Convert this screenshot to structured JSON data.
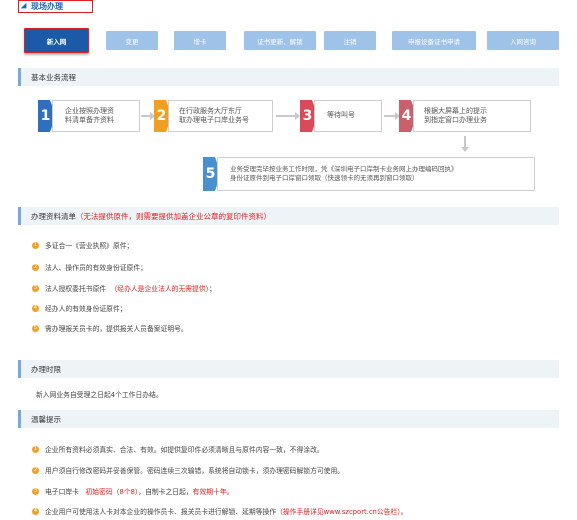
{
  "header": {
    "title": "现场办理"
  },
  "tabs": [
    {
      "label": "新入网"
    },
    {
      "label": "变更"
    },
    {
      "label": "增卡"
    },
    {
      "label": "证书更新、解锁"
    },
    {
      "label": "注销"
    },
    {
      "label": "申报设备证书申请"
    },
    {
      "label": "入网咨询"
    }
  ],
  "process": {
    "heading": "基本业务流程",
    "steps": [
      {
        "num": "1",
        "line1": "企业按照办理资",
        "line2": "料清单备齐资料"
      },
      {
        "num": "2",
        "line1": "在行政服务大厅东厅",
        "line2": "取办理电子口岸业务号"
      },
      {
        "num": "3",
        "line1": "等待叫号",
        "line2": ""
      },
      {
        "num": "4",
        "line1": "根据大屏幕上的提示",
        "line2": "到指定窗口办理业务"
      },
      {
        "num": "5",
        "line1": "业务受理完毕按业务工作时限，凭《深圳电子口岸制卡业务网上办理编码回执》",
        "line2": "身份证原件到电子口岸窗口领取（快速领卡的无须再到窗口领取）"
      }
    ]
  },
  "materials": {
    "heading": "办理资料清单",
    "note": "（无法提供原件，则需要提供加盖企业公章的复印件资料）",
    "items": [
      {
        "num": "1",
        "text": "多证合一《营业执照》原件；",
        "note": "",
        "tail": ""
      },
      {
        "num": "2",
        "text": "法人、操作员的有效身份证原件；",
        "note": "",
        "tail": ""
      },
      {
        "num": "3",
        "text": "法人授权委托书原件",
        "note": "（经办人是企业法人的无需提供）",
        "tail": "；"
      },
      {
        "num": "4",
        "text": "经办人的有效身份证原件；",
        "note": "",
        "tail": ""
      },
      {
        "num": "5",
        "text": "需办理报关员卡的，提供报关人员备案证明号。",
        "note": "",
        "tail": ""
      }
    ]
  },
  "time_limit": {
    "heading": "办理时限",
    "text": "新入网业务自受理之日起4个工作日办结。"
  },
  "tips": {
    "heading": "温馨提示",
    "items": [
      {
        "num": "1",
        "text": "企业所有资料必须真实、合法、有效。如提供复印件必须清晰且与原件内容一致，不得涂改。"
      },
      {
        "num": "2",
        "text": "用户须自行修改密码并妥善保管。密码连续三次输错，系统将自动锁卡，须办理密码解锁方可使用。"
      },
      {
        "num": "3",
        "text": "电子口岸卡",
        "red1": "初始密码（8个8）",
        "mid": "，自制卡之日起，",
        "red2": "有效期十年。"
      },
      {
        "num": "4",
        "text": "企业用户可使用法人卡对本企业的操作员卡、报关员卡进行解锁、延期等操作",
        "red1": "（操作手册详见www.szcport.cn公告栏）。"
      }
    ]
  }
}
